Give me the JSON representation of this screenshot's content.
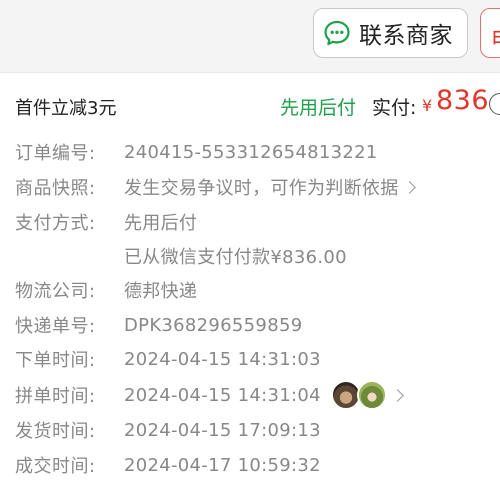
{
  "header": {
    "contact_button": {
      "label": "联系商家",
      "icon": "chat-bubble-icon",
      "color": "#21a04a"
    },
    "other_button": {
      "label": "申"
    }
  },
  "summary": {
    "discount": "首件立减3元",
    "pay_method": "先用后付",
    "actual_label": "实付:",
    "currency": "¥",
    "amount": "836",
    "accent_color": "#e2352b",
    "green_color": "#21a04a"
  },
  "details": {
    "order_no": {
      "label": "订单编号:",
      "value": "240415-553312654813221"
    },
    "snapshot": {
      "label": "商品快照:",
      "value": "发生交易争议时，可作为判断依据"
    },
    "payment": {
      "label": "支付方式:",
      "value": "先用后付",
      "sub_value": "已从微信支付付款¥836.00"
    },
    "logistics": {
      "label": "物流公司:",
      "value": "德邦快递"
    },
    "tracking": {
      "label": "快递单号:",
      "value": "DPK368296559859"
    },
    "order_time": {
      "label": "下单时间:",
      "value": "2024-04-15 14:31:03"
    },
    "group_time": {
      "label": "拼单时间:",
      "value": "2024-04-15 14:31:04"
    },
    "ship_time": {
      "label": "发货时间:",
      "value": "2024-04-15 17:09:13"
    },
    "deal_time": {
      "label": "成交时间:",
      "value": "2024-04-17 10:59:32"
    }
  }
}
